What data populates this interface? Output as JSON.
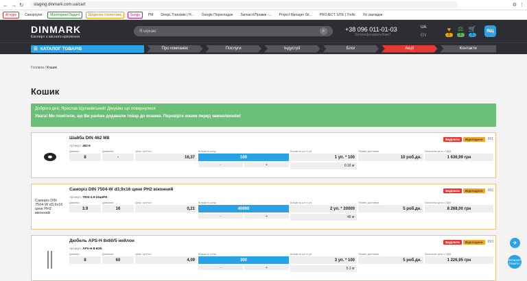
{
  "browser": {
    "url": "staging.dinmark.com.ua/cart",
    "bookmarks": [
      "AI курс",
      "Синхроупи",
      "Моніторинг/Задачі",
      "Щоденна статистика",
      "Songs",
      "PM",
      "DeepL Translate | Н...",
      "Google Перекладач",
      "Запчасті/Правки -...",
      "Project Manager Sit...",
      "PROJECT SITE | Trello",
      "Усі закладки"
    ]
  },
  "header": {
    "logo": "DINMARK",
    "tagline": "Експерт з місного кріплення",
    "search_placeholder": "Я шукаю",
    "phone": "+38 096 011-01-03",
    "callback": "Зателефонувати Вам?",
    "lang_ua": "UA",
    "lang_en": "EN",
    "fav_count": "2",
    "compare_count": "0",
    "cart_count": "3",
    "user": "ЯЩ"
  },
  "menu": {
    "catalog": "КАТАЛОГ ТОВАРІВ",
    "items": [
      "Про компанію",
      "Послуги",
      "Індустрії",
      "Блог",
      "Акції",
      "Контакти"
    ]
  },
  "breadcrumb": {
    "home": "Головна",
    "current": "Кошик"
  },
  "page_title": "Кошик",
  "notice": {
    "greeting": "Доброго дня, Ярослав Щупаківський! Дякуємо що повернулися",
    "warning": "Увага! Ми помітили, що Ви раніше додавали товар до кошика. Перевірте кошик перед замовленням!"
  },
  "labels": {
    "diameter": "Діаметр",
    "length": "Довжина",
    "price": "Ціна, грн/*шт",
    "qty": "Кількість штук",
    "pack": "Кількість шт в уп.",
    "term": "Термін доставки",
    "total": "Загальна ціна з ПДВ",
    "article": "Артикул:",
    "select": "Виділити",
    "to_order": "Відкладено",
    "minus": "-",
    "plus": "+"
  },
  "items": [
    {
      "name": "Шайба DIN 462 M8",
      "idx": "001",
      "article": "462-8",
      "diameter": "8",
      "length": "-",
      "price": "16,37",
      "qty": "100",
      "pack": "1 уп. * 100",
      "weight": "0.16 кг",
      "term": "10 роб.дн.",
      "total": "1 636,99 грн",
      "thumb_alt": ""
    },
    {
      "name": "Саморіз DIN 7504-W d3,9x16 цинк PH2 віконний",
      "idx": "002",
      "article": "7504-3,9-16цнРН",
      "diameter": "3.9",
      "length": "16",
      "price": "0,21",
      "qty": "40000",
      "pack": "2 уп. * 20000",
      "weight": "46 кг",
      "term": "5 роб.дн.",
      "total": "8 268,00 грн",
      "thumb_alt": "Саморіз DIN 7504-W d3,9x16 цинк PH2 віконний"
    },
    {
      "name": "Дюбель APS-H 8x60/5 нейлон",
      "idx": "003",
      "article": "APS-H-8-60/5",
      "diameter": "8",
      "length": "60",
      "price": "4,09",
      "qty": "300",
      "pack": "3 уп. * 100",
      "weight": "5.1 кг",
      "term": "5 роб.дн.",
      "total": "1 226,95 грн",
      "thumb_alt": ""
    }
  ],
  "floats": {
    "help": "Питання? Пишіть!"
  }
}
